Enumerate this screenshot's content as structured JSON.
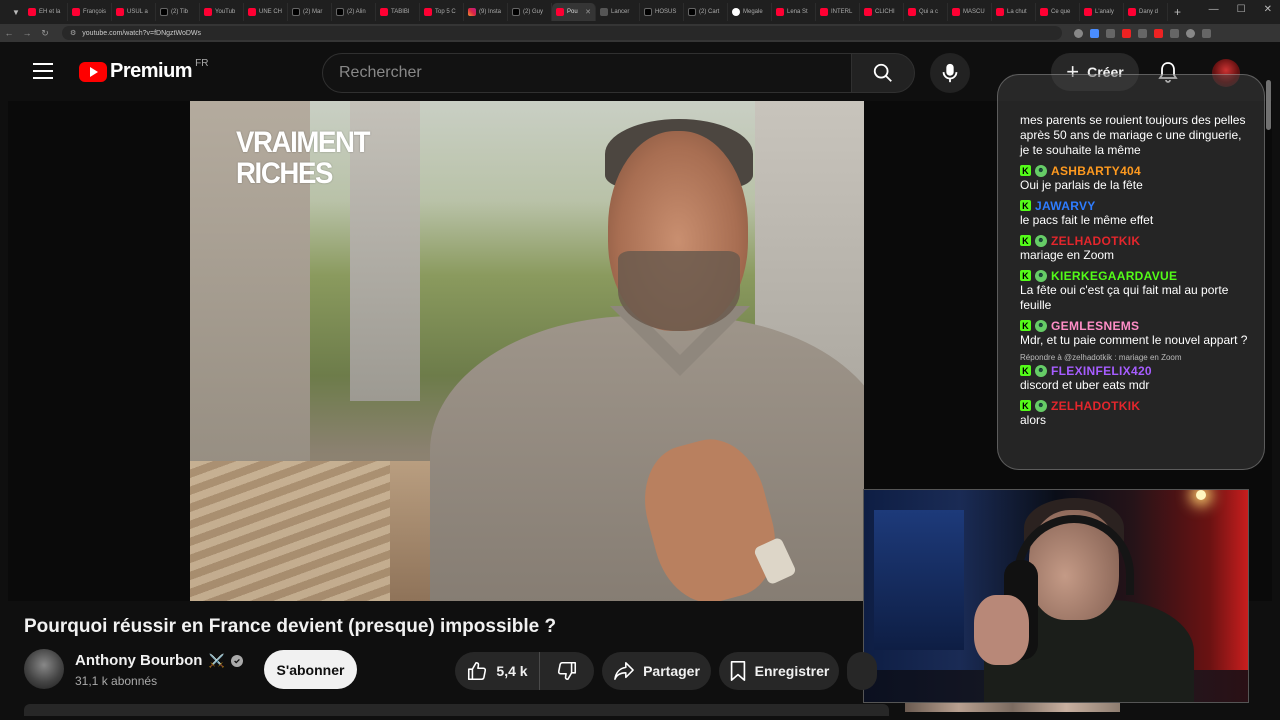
{
  "browser": {
    "tabs": [
      {
        "label": "EH et la",
        "fav": "youtube"
      },
      {
        "label": "François",
        "fav": "youtube"
      },
      {
        "label": "USUL a",
        "fav": "youtube"
      },
      {
        "label": "(2) Tib",
        "fav": "x"
      },
      {
        "label": "YouTub",
        "fav": "youtube"
      },
      {
        "label": "UNE CH",
        "fav": "youtube"
      },
      {
        "label": "(2) Mar",
        "fav": "x"
      },
      {
        "label": "(2) Alin",
        "fav": "x"
      },
      {
        "label": "TABIBI",
        "fav": "youtube"
      },
      {
        "label": "Top 5 C",
        "fav": "youtube"
      },
      {
        "label": "(9) Insta",
        "fav": "instagram"
      },
      {
        "label": "(2) Guy",
        "fav": "x"
      },
      {
        "label": "Pou",
        "fav": "youtube",
        "active": true
      },
      {
        "label": "Lancer",
        "fav": "generic"
      },
      {
        "label": "HOSUS",
        "fav": "x"
      },
      {
        "label": "(2) Cart",
        "fav": "x"
      },
      {
        "label": "Megale",
        "fav": "github"
      },
      {
        "label": "Lena St",
        "fav": "youtube"
      },
      {
        "label": "INTERL",
        "fav": "youtube"
      },
      {
        "label": "CLICHI",
        "fav": "youtube"
      },
      {
        "label": "Qui a c",
        "fav": "youtube"
      },
      {
        "label": "MASCU",
        "fav": "youtube"
      },
      {
        "label": "La chut",
        "fav": "youtube"
      },
      {
        "label": "Ce que",
        "fav": "youtube"
      },
      {
        "label": "L'analy",
        "fav": "youtube"
      },
      {
        "label": "Dany d",
        "fav": "youtube"
      }
    ],
    "new_tab": "+",
    "url": "youtube.com/watch?v=fDNgztWoDWs"
  },
  "header": {
    "logo_text": "Premium",
    "country": "FR",
    "search_placeholder": "Rechercher",
    "create_label": "Créer"
  },
  "video": {
    "overlay_title_line1": "VRAIMENT",
    "overlay_title_line2": "RICHES"
  },
  "chat": {
    "messages": [
      {
        "user": "",
        "color": "#ffffff",
        "text": "mes parents se rouient toujours des pelles après 50 ans de mariage c une dinguerie, je te souhaite la même",
        "faded_start": true
      },
      {
        "user": "ASHBARTY404",
        "color": "#ff9a1f",
        "text": "Oui je parlais de la fête"
      },
      {
        "user": "JAWARVY",
        "color": "#2e7cff",
        "text": "le pacs fait le même effet"
      },
      {
        "user": "ZELHADOTKIK",
        "color": "#e4262c",
        "text": "mariage en Zoom"
      },
      {
        "user": "KIERKEGAARDAVUE",
        "color": "#53fc18",
        "text": "La fête oui c'est ça qui fait mal au porte feuille"
      },
      {
        "user": "GEMLESNEMS",
        "color": "#ff8ec7",
        "text": "Mdr, et tu paie comment le nouvel appart ?"
      },
      {
        "user": "FLEXINFELIX420",
        "color": "#a65dff",
        "text": "discord et uber eats mdr",
        "reply": "Répondre à @zelhadotkik : mariage en Zoom"
      },
      {
        "user": "ZELHADOTKIK",
        "color": "#e4262c",
        "text": "alors"
      }
    ]
  },
  "meta": {
    "title": "Pourquoi réussir en France devient (presque) impossible ?",
    "channel": "Anthony Bourbon",
    "channel_emoji": "⚔️",
    "subscribers": "31,1 k abonnés",
    "subscribe_label": "S'abonner",
    "likes": "5,4 k",
    "share_label": "Partager",
    "save_label": "Enregistrer"
  }
}
